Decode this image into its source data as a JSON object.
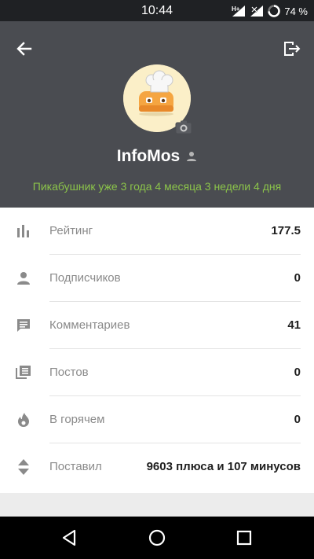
{
  "status_bar": {
    "time": "10:44",
    "network_label": "H+",
    "battery_percent": "74 %",
    "battery_level": 0.74,
    "icons": [
      "signal-icon",
      "no-signal-icon",
      "battery-ring-icon"
    ]
  },
  "header": {
    "back_icon": "arrow-left-icon",
    "logout_icon": "logout-icon",
    "avatar_icon": "chef-toaster-avatar",
    "camera_icon": "camera-icon",
    "username": "InfoMos",
    "username_badge_icon": "person-icon",
    "tenure": "Пикабушник уже 3 года 4 месяца 3 недели 4 дня",
    "tenure_color": "#8bc34a",
    "background": "#4a4c51"
  },
  "stats": [
    {
      "label": "Рейтинг",
      "value": "177.5",
      "icon": "bar-chart-icon"
    },
    {
      "label": "Подписчиков",
      "value": "0",
      "icon": "person-icon"
    },
    {
      "label": "Комментариев",
      "value": "41",
      "icon": "comment-icon"
    },
    {
      "label": "Постов",
      "value": "0",
      "icon": "posts-stack-icon"
    },
    {
      "label": "В горячем",
      "value": "0",
      "icon": "flame-icon"
    },
    {
      "label": "Поставил",
      "value": "9603 плюса и 107 минусов",
      "icon": "up-down-icon"
    }
  ],
  "nav_bar": {
    "icons": [
      "nav-back-triangle-icon",
      "nav-home-circle-icon",
      "nav-recents-square-icon"
    ]
  }
}
